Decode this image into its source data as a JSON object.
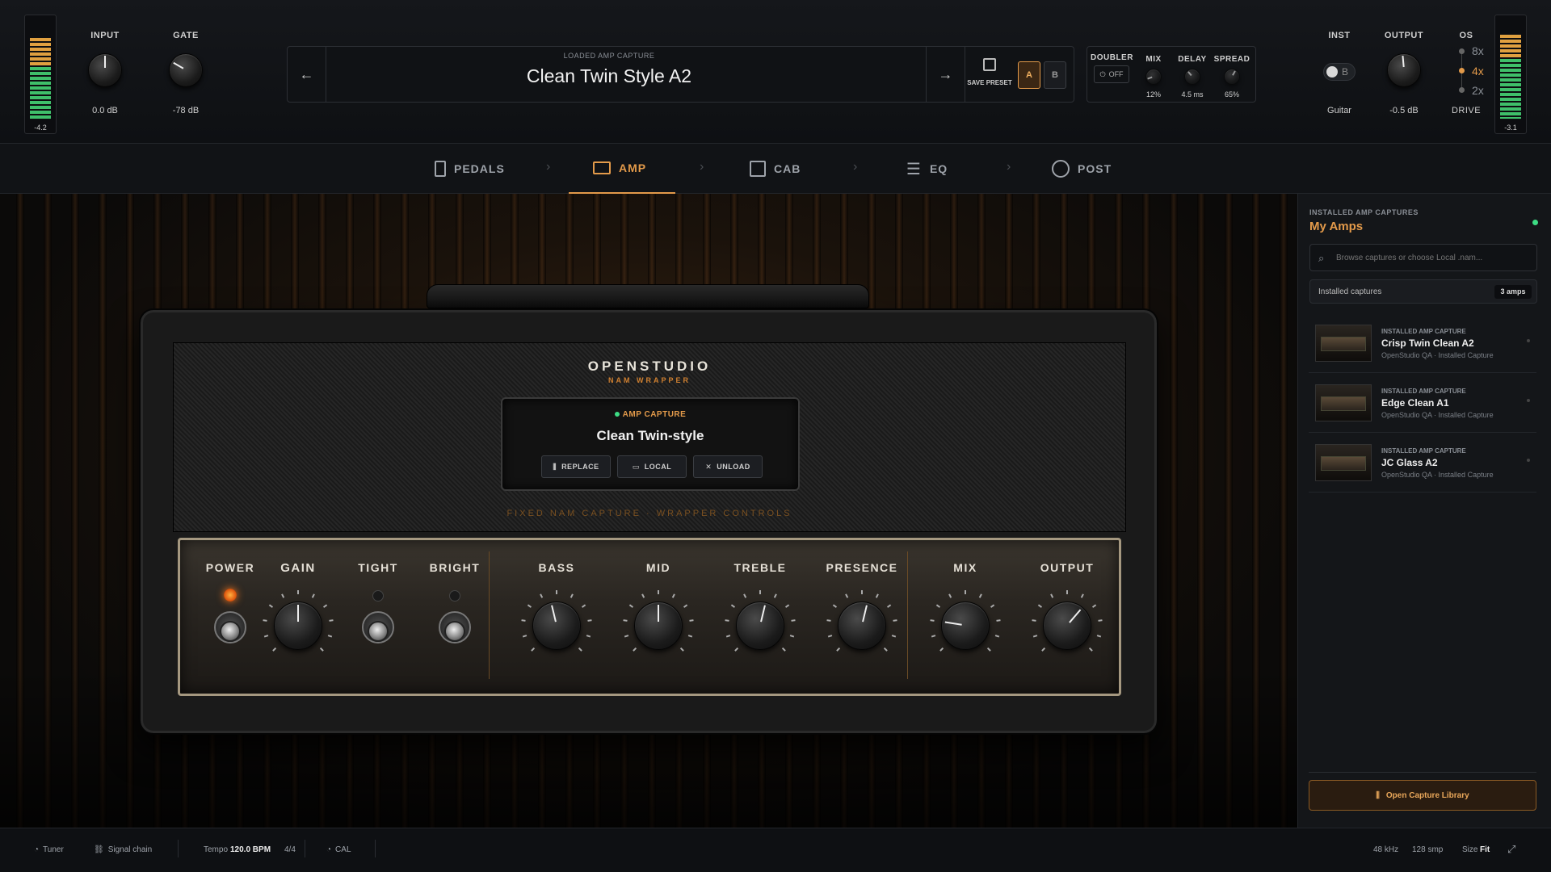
{
  "header": {
    "input": {
      "label": "INPUT",
      "value": "0.0 dB",
      "meter": "-4.2"
    },
    "gate": {
      "label": "GATE",
      "value": "-78 dB"
    },
    "preset": {
      "caption": "LOADED AMP CAPTURE",
      "name": "Clean Twin Style A2",
      "save_label": "SAVE PRESET",
      "slot_a": "A",
      "slot_b": "B"
    },
    "doubler": {
      "label": "DOUBLER",
      "power": "OFF",
      "mix_label": "MIX",
      "mix_value": "12%",
      "delay_label": "DELAY",
      "delay_value": "4.5 ms",
      "spread_label": "SPREAD",
      "spread_value": "65%"
    },
    "inst": {
      "label": "INST",
      "toggle_letter": "B",
      "value": "Guitar"
    },
    "output": {
      "label": "OUTPUT",
      "value": "-0.5 dB",
      "meter": "-3.1"
    },
    "os": {
      "label": "OS",
      "options": [
        "8x",
        "4x",
        "2x"
      ],
      "drive": "DRIVE"
    }
  },
  "tabs": [
    {
      "label": "PEDALS",
      "icon": "pedal-icon"
    },
    {
      "label": "AMP",
      "icon": "amp-icon"
    },
    {
      "label": "CAB",
      "icon": "cab-icon"
    },
    {
      "label": "EQ",
      "icon": "eq-icon"
    },
    {
      "label": "POST",
      "icon": "gauge-icon"
    }
  ],
  "amp": {
    "brand": "OPENSTUDIO",
    "subbrand": "NAM WRAPPER",
    "capture_tag": "AMP CAPTURE",
    "capture_name": "Clean Twin-style",
    "replace_label": "REPLACE",
    "local_label": "LOCAL",
    "unload_label": "UNLOAD",
    "strip_text": "FIXED NAM CAPTURE · WRAPPER CONTROLS",
    "controls": [
      "POWER",
      "GAIN",
      "TIGHT",
      "BRIGHT",
      "BASS",
      "MID",
      "TREBLE",
      "PRESENCE",
      "MIX",
      "OUTPUT"
    ],
    "knob_levels": {
      "gain": 0.5,
      "bass": 0.45,
      "mid": 0.5,
      "treble": 0.55,
      "presence": 0.55,
      "mix": 0.2,
      "output": 0.65
    }
  },
  "sidebar": {
    "caption": "INSTALLED AMP CAPTURES",
    "title": "My Amps",
    "search_placeholder": "Browse captures or choose Local .nam...",
    "filter_label": "Installed captures",
    "count": "3 amps",
    "items": [
      {
        "tag": "INSTALLED AMP CAPTURE",
        "name": "Crisp Twin Clean A2",
        "meta": "OpenStudio QA · Installed Capture"
      },
      {
        "tag": "INSTALLED AMP CAPTURE",
        "name": "Edge Clean A1",
        "meta": "OpenStudio QA · Installed Capture"
      },
      {
        "tag": "INSTALLED AMP CAPTURE",
        "name": "JC Glass A2",
        "meta": "OpenStudio QA · Installed Capture"
      }
    ],
    "open_library": "Open Capture Library"
  },
  "footer": {
    "tuner": "Tuner",
    "signal_chain": "Signal chain",
    "tempo_label": "Tempo",
    "tempo_value": "120.0 BPM",
    "meter": "4/4",
    "cal": "CAL",
    "sample_rate": "48 kHz",
    "buffer": "128 smp",
    "size_label": "Size",
    "size_value": "Fit"
  },
  "colors": {
    "accent": "#e39a4a",
    "meter_green": "#3fbf6a",
    "meter_orange": "#e0a040",
    "online": "#3ddc84"
  }
}
